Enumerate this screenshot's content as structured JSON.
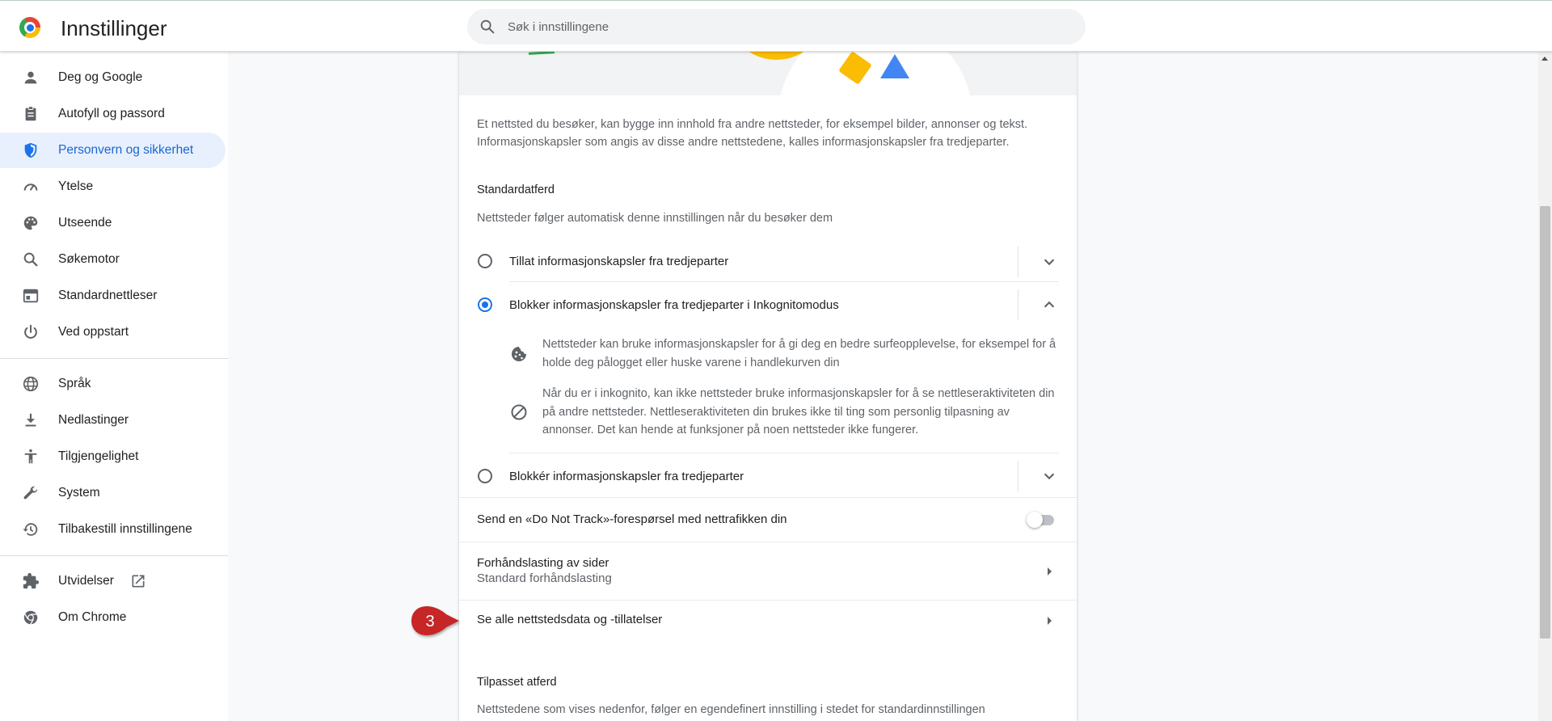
{
  "header": {
    "title": "Innstillinger",
    "search_placeholder": "Søk i innstillingene"
  },
  "sidebar": {
    "items": [
      {
        "label": "Deg og Google",
        "icon": "person-icon"
      },
      {
        "label": "Autofyll og passord",
        "icon": "clipboard-icon"
      },
      {
        "label": "Personvern og sikkerhet",
        "icon": "shield-icon",
        "active": true
      },
      {
        "label": "Ytelse",
        "icon": "speedometer-icon"
      },
      {
        "label": "Utseende",
        "icon": "palette-icon"
      },
      {
        "label": "Søkemotor",
        "icon": "search-icon"
      },
      {
        "label": "Standardnettleser",
        "icon": "browser-icon"
      },
      {
        "label": "Ved oppstart",
        "icon": "power-icon"
      },
      {
        "label": "Språk",
        "icon": "globe-icon"
      },
      {
        "label": "Nedlastinger",
        "icon": "download-icon"
      },
      {
        "label": "Tilgjengelighet",
        "icon": "accessibility-icon"
      },
      {
        "label": "System",
        "icon": "wrench-icon"
      },
      {
        "label": "Tilbakestill innstillingene",
        "icon": "history-icon"
      },
      {
        "label": "Utvidelser",
        "icon": "puzzle-icon"
      },
      {
        "label": "Om Chrome",
        "icon": "chrome-icon"
      }
    ]
  },
  "content": {
    "intro": "Et nettsted du besøker, kan bygge inn innhold fra andre nettsteder, for eksempel bilder, annonser og tekst. Informasjonskapsler som angis av disse andre nettstedene, kalles informasjonskapsler fra tredjeparter.",
    "default_heading": "Standardatferd",
    "default_desc": "Nettsteder følger automatisk denne innstillingen når du besøker dem",
    "options": [
      {
        "label": "Tillat informasjonskapsler fra tredjeparter",
        "selected": false
      },
      {
        "label": "Blokker informasjonskapsler fra tredjeparter i Inkognitomodus",
        "selected": true
      },
      {
        "label": "Blokkér informasjonskapsler fra tredjeparter",
        "selected": false
      }
    ],
    "expanded_details": [
      {
        "icon": "cookie-icon",
        "text": "Nettsteder kan bruke informasjonskapsler for å gi deg en bedre surfeopplevelse, for eksempel for å holde deg pålogget eller huske varene i handlekurven din"
      },
      {
        "icon": "block-icon",
        "text": "Når du er i inkognito, kan ikke nettsteder bruke informasjonskapsler for å se nettleseraktiviteten din på andre nettsteder. Nettleseraktiviteten din brukes ikke til ting som personlig tilpasning av annonser. Det kan hende at funksjoner på noen nettsteder ikke fungerer."
      }
    ],
    "dnt_label": "Send en «Do Not Track»-forespørsel med nettrafikken din",
    "dnt_enabled": false,
    "preload_title": "Forhåndslasting av sider",
    "preload_sub": "Standard forhåndslasting",
    "site_data_label": "Se alle nettstedsdata og -tillatelser",
    "custom_heading": "Tilpasset atferd",
    "custom_desc": "Nettstedene som vises nedenfor, følger en egendefinert innstilling i stedet for standardinnstillingen"
  },
  "callout": {
    "number": "3",
    "color": "#c62828"
  },
  "colors": {
    "accent": "#1a73e8",
    "active_bg": "#e8f0fe",
    "active_text": "#1967d2"
  }
}
